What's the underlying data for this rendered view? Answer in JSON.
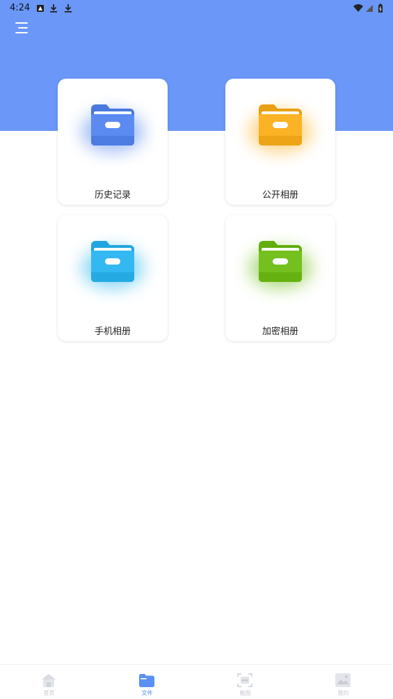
{
  "status_bar": {
    "time": "4:24",
    "icons": [
      "notification-icon",
      "download-icon",
      "download-icon",
      "wifi-icon",
      "signal-icon",
      "battery-icon"
    ]
  },
  "header": {
    "menu_icon": "menu-icon",
    "background_color": "#6a97f8"
  },
  "folders": [
    {
      "label": "历史记录",
      "icon": "folder-icon",
      "color": "#5b8af0"
    },
    {
      "label": "公开相册",
      "icon": "folder-icon",
      "color": "#fbb224"
    },
    {
      "label": "手机相册",
      "icon": "folder-icon",
      "color": "#33b8f1"
    },
    {
      "label": "加密相册",
      "icon": "folder-icon",
      "color": "#73c01f"
    }
  ],
  "bottom_nav": {
    "active_color": "#5b8ff2",
    "inactive_color": "#c5c8d1",
    "items": [
      {
        "label": "首页",
        "icon": "home-icon",
        "active": false
      },
      {
        "label": "文件",
        "icon": "folder-icon",
        "active": true
      },
      {
        "label": "截图",
        "icon": "screenshot-icon",
        "active": false
      },
      {
        "label": "我的",
        "icon": "image-icon",
        "active": false
      }
    ]
  }
}
